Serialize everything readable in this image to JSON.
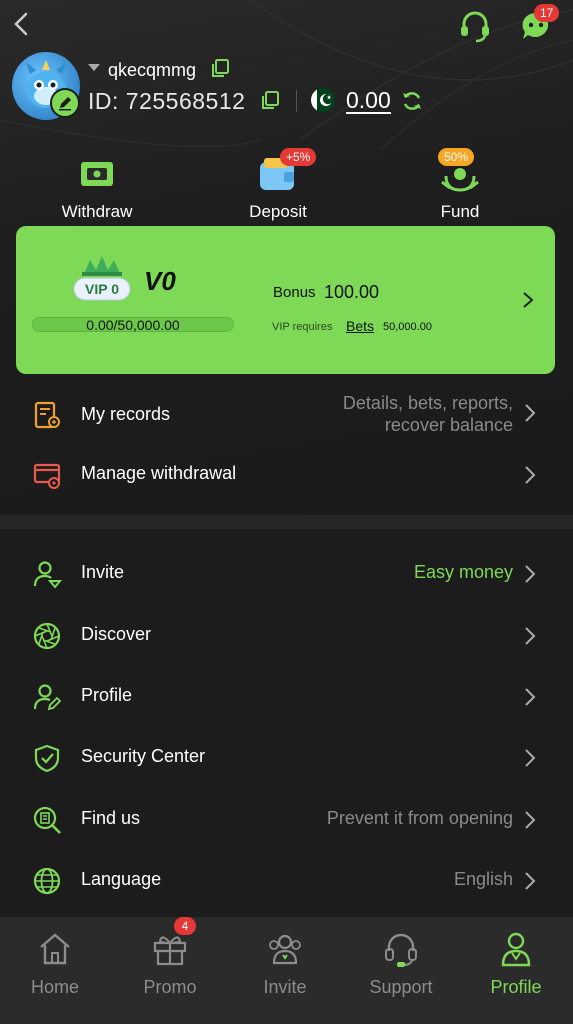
{
  "header": {
    "username": "qkecqmmg",
    "id_label": "ID: 725568512",
    "balance": "0.00",
    "message_badge": "17"
  },
  "actions": [
    {
      "label": "Withdraw",
      "icon": "withdraw-icon"
    },
    {
      "label": "Deposit",
      "icon": "wallet-icon",
      "pill": "+5%"
    },
    {
      "label": "Fund",
      "icon": "fund-icon",
      "pill": "50%"
    }
  ],
  "vip": {
    "badge_text": "VIP 0",
    "level": "V0",
    "progress_text": "0.00/50,000.00",
    "progress_fraction": 0,
    "bonus_label": "Bonus",
    "bonus_value": "100.00",
    "requires_label": "VIP requires",
    "requires_link": "Bets",
    "requires_value": "50,000.00"
  },
  "menu_top": [
    {
      "label": "My records",
      "value_line1": "Details, bets, reports,",
      "value_line2": "recover balance",
      "icon": "records-icon"
    },
    {
      "label": "Manage withdrawal",
      "value": "",
      "icon": "card-settings-icon"
    }
  ],
  "menu": [
    {
      "label": "Invite",
      "value": "Easy money",
      "icon": "invite-user-icon"
    },
    {
      "label": "Discover",
      "value": "",
      "icon": "aperture-icon"
    },
    {
      "label": "Profile",
      "value": "",
      "icon": "user-edit-icon"
    },
    {
      "label": "Security Center",
      "value": "",
      "icon": "shield-check-icon"
    },
    {
      "label": "Find us",
      "value": "Prevent it from opening",
      "icon": "find-building-icon"
    },
    {
      "label": "Language",
      "value": "English",
      "icon": "globe-icon"
    }
  ],
  "tabs": [
    {
      "label": "Home",
      "icon": "home-icon"
    },
    {
      "label": "Promo",
      "icon": "gift-icon",
      "badge": "4"
    },
    {
      "label": "Invite",
      "icon": "group-icon"
    },
    {
      "label": "Support",
      "icon": "headset-icon"
    },
    {
      "label": "Profile",
      "icon": "person-icon",
      "active": true
    }
  ],
  "colors": {
    "accent": "#7ed957",
    "background": "#1c1c1c",
    "tabbar": "#2b2b2b",
    "badge": "#e53935",
    "fund_pill": "#f5a623"
  }
}
